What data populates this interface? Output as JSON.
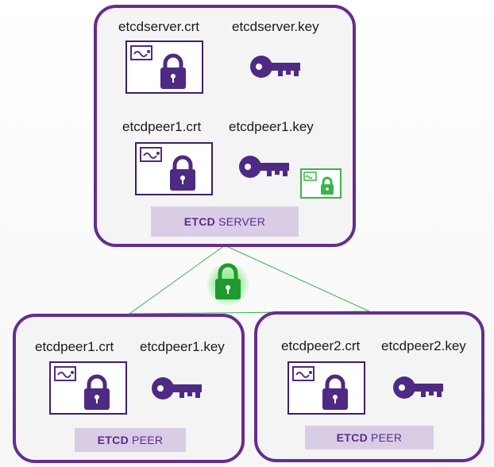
{
  "server": {
    "cert1": "etcdserver.crt",
    "key1": "etcdserver.key",
    "cert2": "etcdpeer1.crt",
    "key2": "etcdpeer1.key",
    "banner_bold": "ETCD",
    "banner_rest": "SERVER"
  },
  "peer1": {
    "cert": "etcdpeer1.crt",
    "key": "etcdpeer1.key",
    "banner_bold": "ETCD",
    "banner_rest": "PEER"
  },
  "peer2": {
    "cert": "etcdpeer2.crt",
    "key": "etcdpeer2.key",
    "banner_bold": "ETCD",
    "banner_rest": "PEER"
  },
  "colors": {
    "border": "#652d90",
    "icon": "#4e2a84",
    "banner_bg": "#d9cde6",
    "tls_green": "#39b54a"
  },
  "icons": [
    "certificate-icon",
    "lock-icon",
    "key-icon",
    "green-ca-certificate-icon",
    "green-tls-lock-icon"
  ]
}
